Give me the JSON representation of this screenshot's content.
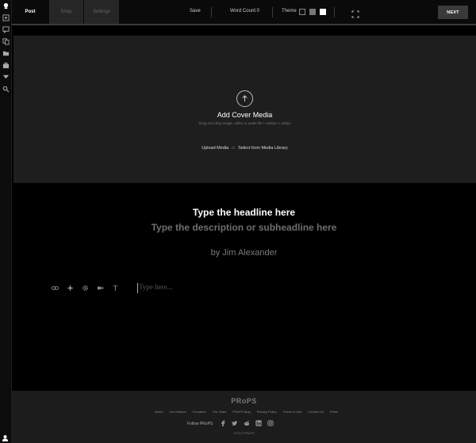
{
  "tabs": [
    {
      "label": "Post"
    },
    {
      "label": "Shop"
    },
    {
      "label": "Settings"
    }
  ],
  "toolbar": {
    "save_label": "Save",
    "word_count_label": "Word Count:",
    "word_count_value": "0",
    "theme_label": "Theme",
    "theme_swatches": [
      "#111111",
      "#777777",
      "#ffffff"
    ],
    "next_label": "NEXT"
  },
  "sidebar": {
    "icons": [
      "logo-icon",
      "new-post-icon",
      "comments-icon",
      "copy-icon",
      "folder-icon",
      "briefcase-icon",
      "tag-icon",
      "search-icon"
    ]
  },
  "cover": {
    "title": "Add Cover Media",
    "subtitle": "Drag and drop image, video or audio file • 1400px x 440px",
    "upload_label": "Upload Media",
    "or_label": "or",
    "library_label": "Select from Media Library"
  },
  "editor": {
    "headline_placeholder": "Type the headline here",
    "subheadline_placeholder": "Type the description or subheadline here",
    "byline": "by Jim Alexander",
    "body_placeholder": "Type here..."
  },
  "footer": {
    "logo": "PRoPS",
    "links": [
      "About",
      "Our Mission",
      "Founders",
      "The Team",
      "PRoPS Blog",
      "Privacy Policy",
      "Terms of Use",
      "Contact Us",
      "Press"
    ],
    "follow_label": "Follow PRoPS",
    "social": [
      "facebook-icon",
      "twitter-icon",
      "reddit-icon",
      "linkedin-icon",
      "instagram-icon"
    ],
    "copyright": "©2017 PRoPS"
  },
  "colors": {
    "background": "#000000",
    "panel": "#1e1e1e",
    "accent_button": "#3a3a3a"
  }
}
